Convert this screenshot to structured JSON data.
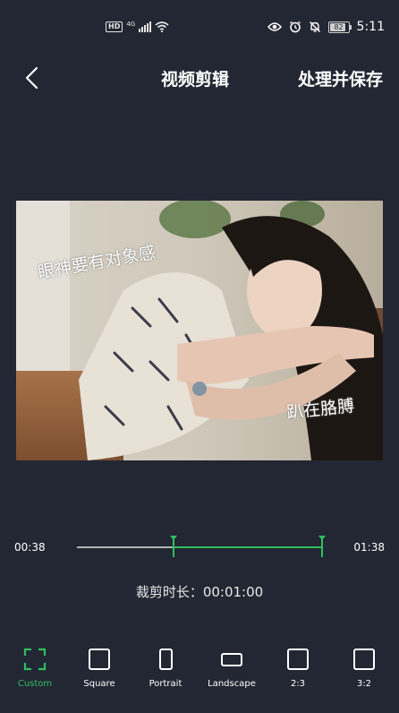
{
  "status_bar": {
    "hd": "HD",
    "network": "4G",
    "battery": "82",
    "time": "5:11"
  },
  "header": {
    "title": "视频剪辑",
    "action": "处理并保存"
  },
  "photo": {
    "caption_left": "眼神要有对象感",
    "caption_right": "趴在胳膊"
  },
  "timeline": {
    "start": "00:38",
    "end": "01:38",
    "selection_start_fraction": 0.39,
    "selection_end_fraction": 1.0
  },
  "duration_text": "裁剪时长：00:01:00",
  "ratios": [
    {
      "label": "Custom",
      "active": true
    },
    {
      "label": "Square",
      "active": false
    },
    {
      "label": "Portrait",
      "active": false
    },
    {
      "label": "Landscape",
      "active": false
    },
    {
      "label": "2:3",
      "active": false
    },
    {
      "label": "3:2",
      "active": false
    }
  ],
  "colors": {
    "background": "#232733",
    "accent": "#2fbf5d"
  }
}
